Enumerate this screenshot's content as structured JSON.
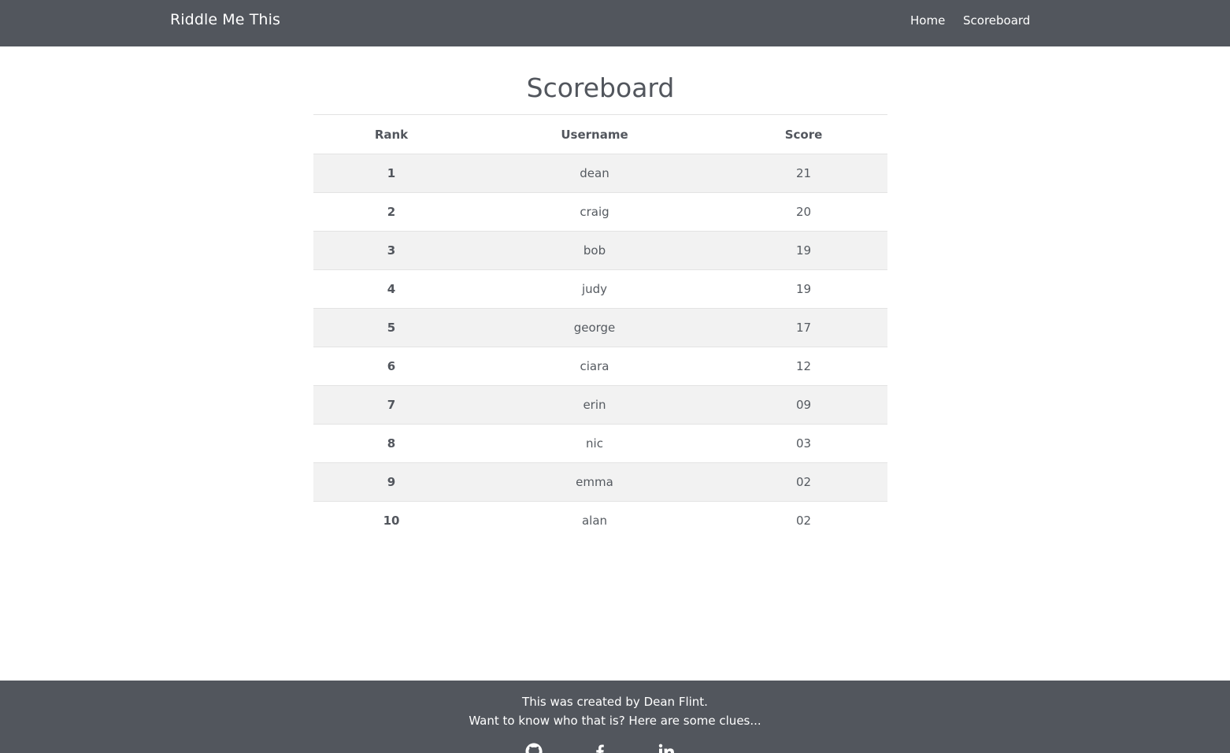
{
  "nav": {
    "brand": "Riddle Me This",
    "links": [
      {
        "label": "Home"
      },
      {
        "label": "Scoreboard"
      }
    ]
  },
  "page": {
    "title": "Scoreboard"
  },
  "table": {
    "headers": [
      "Rank",
      "Username",
      "Score"
    ],
    "rows": [
      {
        "rank": "1",
        "username": "dean",
        "score": "21"
      },
      {
        "rank": "2",
        "username": "craig",
        "score": "20"
      },
      {
        "rank": "3",
        "username": "bob",
        "score": "19"
      },
      {
        "rank": "4",
        "username": "judy",
        "score": "19"
      },
      {
        "rank": "5",
        "username": "george",
        "score": "17"
      },
      {
        "rank": "6",
        "username": "ciara",
        "score": "12"
      },
      {
        "rank": "7",
        "username": "erin",
        "score": "09"
      },
      {
        "rank": "8",
        "username": "nic",
        "score": "03"
      },
      {
        "rank": "9",
        "username": "emma",
        "score": "02"
      },
      {
        "rank": "10",
        "username": "alan",
        "score": "02"
      }
    ]
  },
  "footer": {
    "line1": "This was created by Dean Flint.",
    "line2": "Want to know who that is? Here are some clues...",
    "icons": [
      "github-icon",
      "facebook-icon",
      "linkedin-icon"
    ]
  },
  "colors": {
    "bar": "#52565d",
    "stripe": "#f2f2f2",
    "text": "#555a60"
  }
}
